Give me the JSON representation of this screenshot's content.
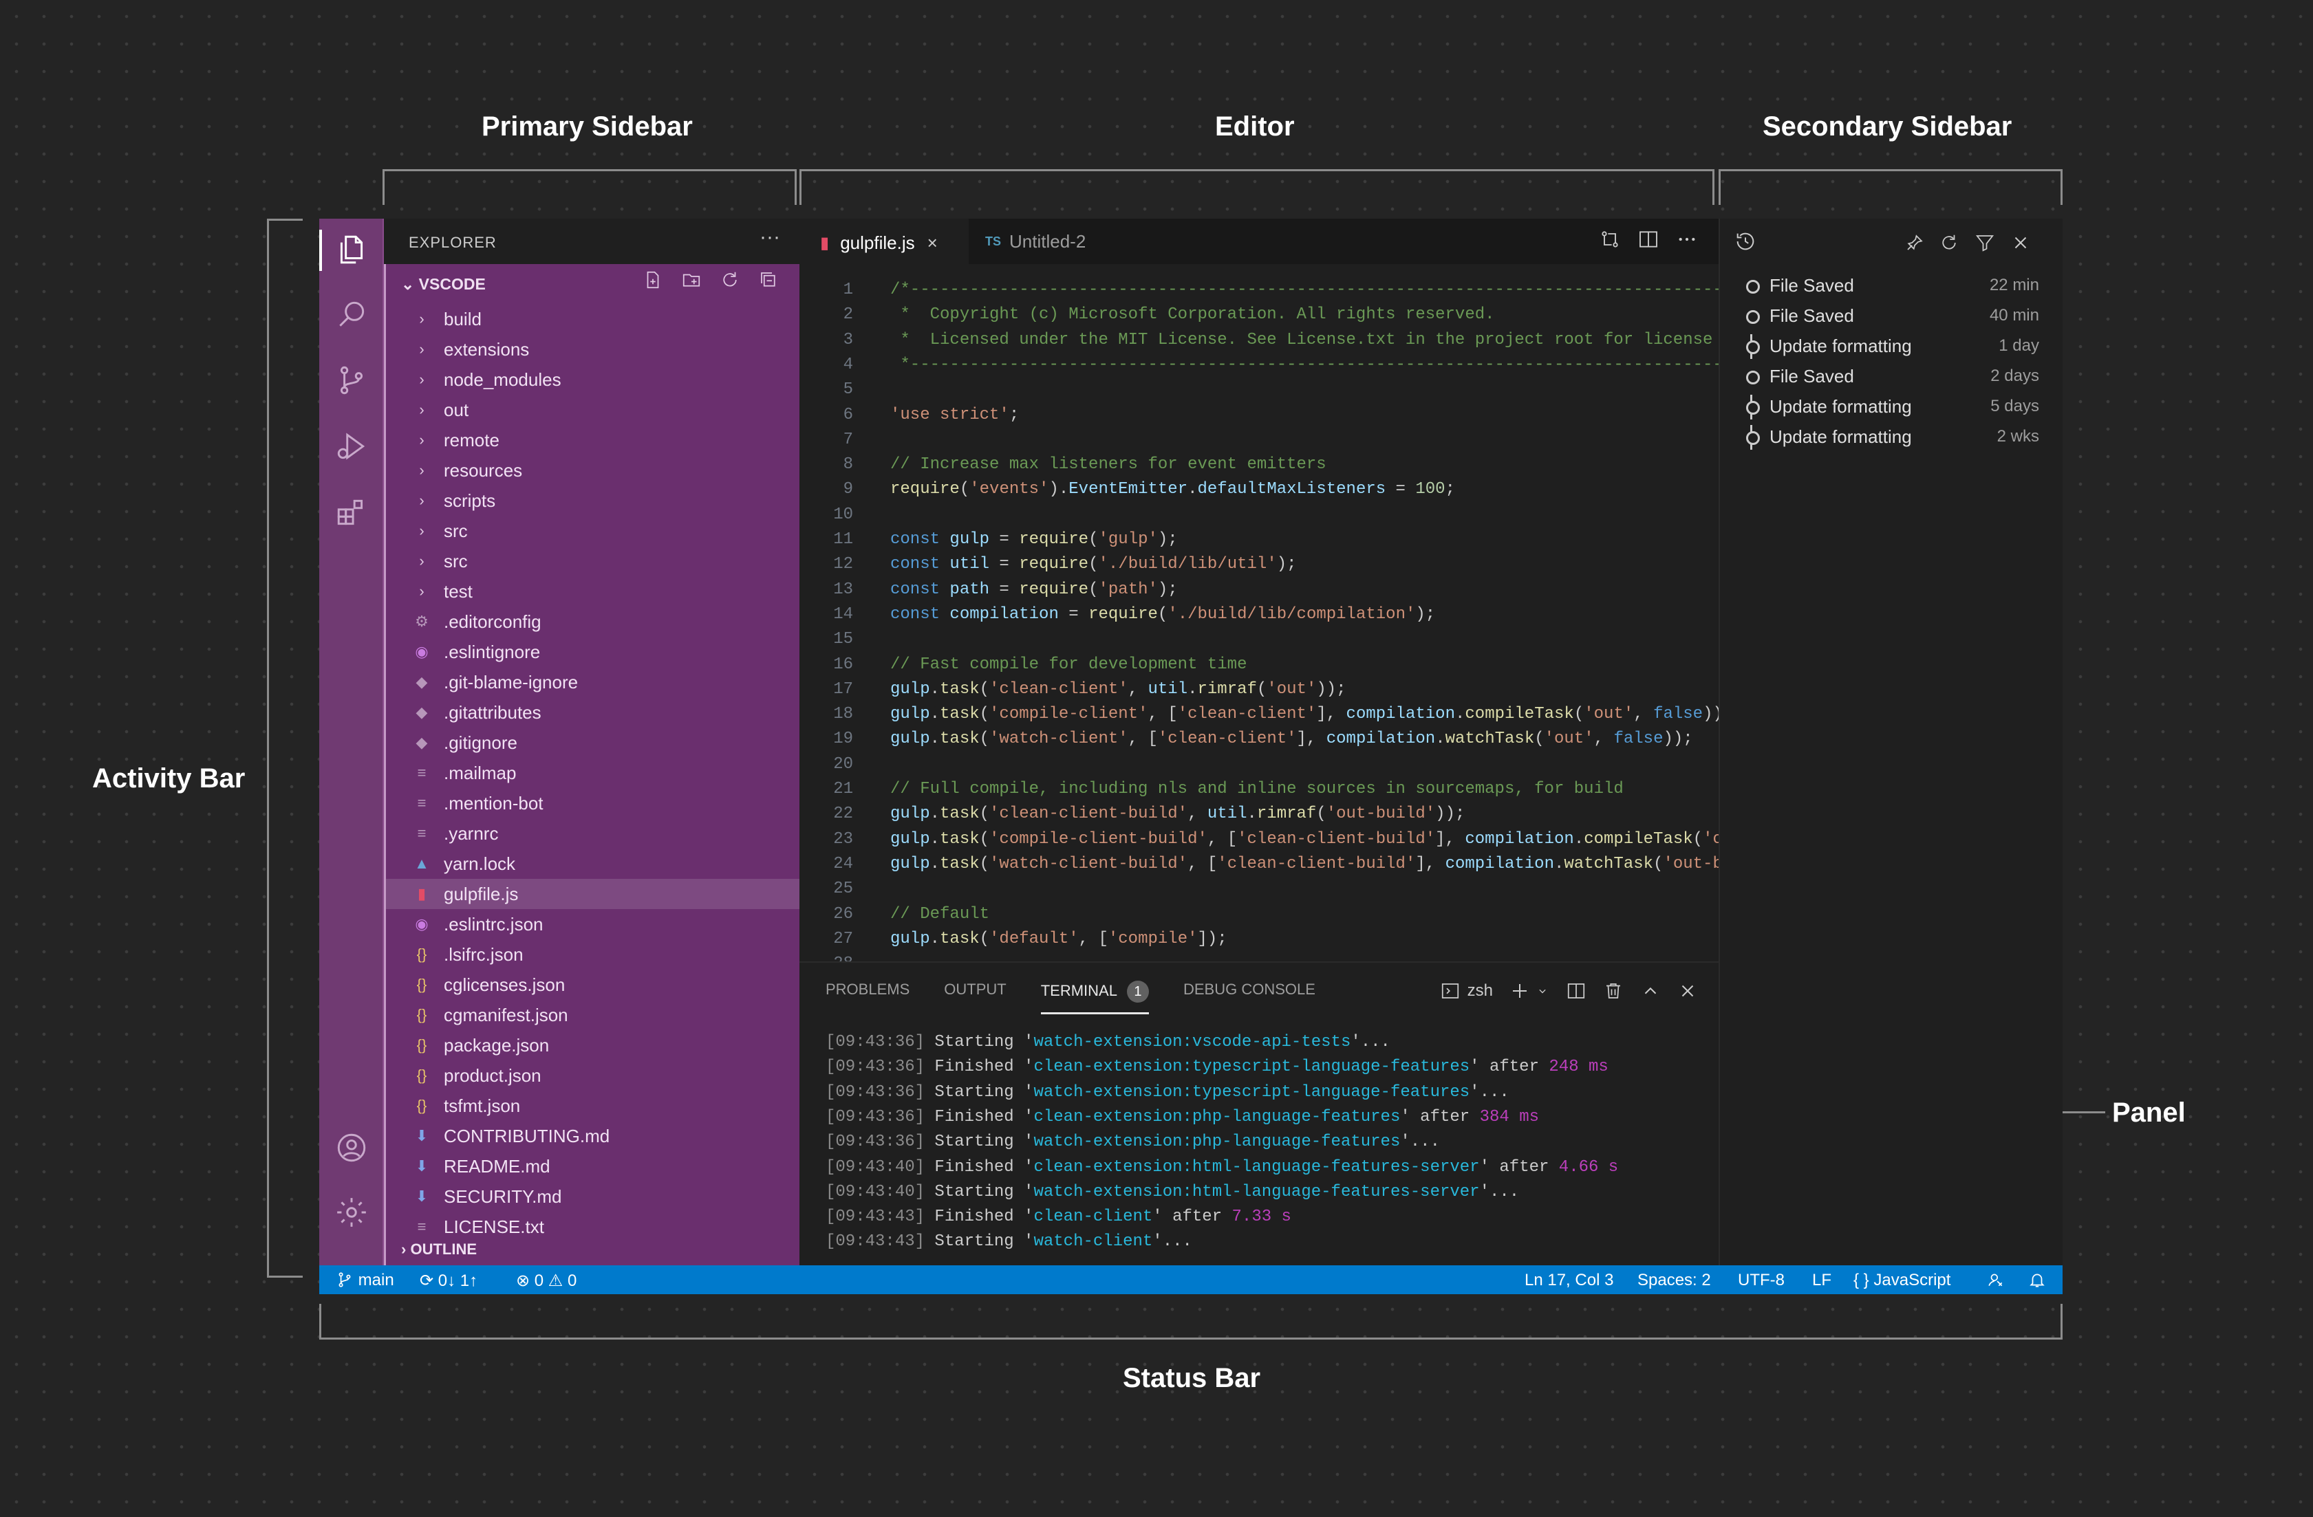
{
  "callouts": {
    "primary_sidebar": "Primary Sidebar",
    "editor": "Editor",
    "secondary_sidebar": "Secondary Sidebar",
    "activity_bar": "Activity Bar",
    "panel": "Panel",
    "status_bar": "Status Bar"
  },
  "activity_bar": {
    "icons": [
      "files-icon",
      "search-icon",
      "source-control-icon",
      "run-debug-icon",
      "extensions-icon",
      "account-icon",
      "settings-gear-icon"
    ]
  },
  "primary_sidebar": {
    "title": "EXPLORER",
    "more": "···",
    "section": "VSCODE",
    "outline": "OUTLINE",
    "tree": [
      {
        "label": "build",
        "icon": "›"
      },
      {
        "label": "extensions",
        "icon": "›"
      },
      {
        "label": "node_modules",
        "icon": "›"
      },
      {
        "label": "out",
        "icon": "›"
      },
      {
        "label": "remote",
        "icon": "›"
      },
      {
        "label": "resources",
        "icon": "›"
      },
      {
        "label": "scripts",
        "icon": "›"
      },
      {
        "label": "src",
        "icon": "›"
      },
      {
        "label": "src",
        "icon": "›"
      },
      {
        "label": "test",
        "icon": "›"
      },
      {
        "label": ".editorconfig",
        "icon": "⚙"
      },
      {
        "label": ".eslintignore",
        "icon": "◉"
      },
      {
        "label": ".git-blame-ignore",
        "icon": "◆"
      },
      {
        "label": ".gitattributes",
        "icon": "◆"
      },
      {
        "label": ".gitignore",
        "icon": "◆"
      },
      {
        "label": ".mailmap",
        "icon": "≡"
      },
      {
        "label": ".mention-bot",
        "icon": "≡"
      },
      {
        "label": ".yarnrc",
        "icon": "≡"
      },
      {
        "label": "yarn.lock",
        "icon": "▲"
      },
      {
        "label": "gulpfile.js",
        "icon": "▮"
      },
      {
        "label": ".eslintrc.json",
        "icon": "◉"
      },
      {
        "label": ".lsifrc.json",
        "icon": "{}"
      },
      {
        "label": "cglicenses.json",
        "icon": "{}"
      },
      {
        "label": "cgmanifest.json",
        "icon": "{}"
      },
      {
        "label": "package.json",
        "icon": "{}"
      },
      {
        "label": "product.json",
        "icon": "{}"
      },
      {
        "label": "tsfmt.json",
        "icon": "{}"
      },
      {
        "label": "CONTRIBUTING.md",
        "icon": "⬇"
      },
      {
        "label": "README.md",
        "icon": "⬇"
      },
      {
        "label": "SECURITY.md",
        "icon": "⬇"
      },
      {
        "label": "LICENSE.txt",
        "icon": "≡"
      }
    ],
    "selected_index": 19
  },
  "editor": {
    "tabs": [
      {
        "label": "gulpfile.js",
        "active": true,
        "close": "×"
      },
      {
        "label": "Untitled-2",
        "active": false,
        "prefix": "TS"
      }
    ],
    "lines": [
      [
        [
          "c-com",
          "/*---------------------------------------------------------------------------------------------"
        ]
      ],
      [
        [
          "c-com",
          " *  Copyright (c) Microsoft Corporation. All rights reserved."
        ]
      ],
      [
        [
          "c-com",
          " *  Licensed under the MIT License. See License.txt in the project root for license information."
        ]
      ],
      [
        [
          "c-com",
          " *--------------------------------------------------------------------------------------------*/"
        ]
      ],
      [],
      [
        [
          "c-str",
          "'use strict'"
        ],
        [
          "c-plain",
          ";"
        ]
      ],
      [],
      [
        [
          "c-com",
          "// Increase max listeners for event emitters"
        ]
      ],
      [
        [
          "c-fn",
          "require"
        ],
        [
          "c-plain",
          "("
        ],
        [
          "c-str",
          "'events'"
        ],
        [
          "c-plain",
          ")."
        ],
        [
          "c-var",
          "EventEmitter"
        ],
        [
          "c-plain",
          "."
        ],
        [
          "c-var",
          "defaultMaxListeners"
        ],
        [
          "c-plain",
          " = "
        ],
        [
          "c-num",
          "100"
        ],
        [
          "c-plain",
          ";"
        ]
      ],
      [],
      [
        [
          "c-kw",
          "const "
        ],
        [
          "c-var",
          "gulp"
        ],
        [
          "c-plain",
          " = "
        ],
        [
          "c-fn",
          "require"
        ],
        [
          "c-plain",
          "("
        ],
        [
          "c-str",
          "'gulp'"
        ],
        [
          "c-plain",
          ");"
        ]
      ],
      [
        [
          "c-kw",
          "const "
        ],
        [
          "c-var",
          "util"
        ],
        [
          "c-plain",
          " = "
        ],
        [
          "c-fn",
          "require"
        ],
        [
          "c-plain",
          "("
        ],
        [
          "c-str",
          "'./build/lib/util'"
        ],
        [
          "c-plain",
          ");"
        ]
      ],
      [
        [
          "c-kw",
          "const "
        ],
        [
          "c-var",
          "path"
        ],
        [
          "c-plain",
          " = "
        ],
        [
          "c-fn",
          "require"
        ],
        [
          "c-plain",
          "("
        ],
        [
          "c-str",
          "'path'"
        ],
        [
          "c-plain",
          ");"
        ]
      ],
      [
        [
          "c-kw",
          "const "
        ],
        [
          "c-var",
          "compilation"
        ],
        [
          "c-plain",
          " = "
        ],
        [
          "c-fn",
          "require"
        ],
        [
          "c-plain",
          "("
        ],
        [
          "c-str",
          "'./build/lib/compilation'"
        ],
        [
          "c-plain",
          ");"
        ]
      ],
      [],
      [
        [
          "c-com",
          "// Fast compile for development time"
        ]
      ],
      [
        [
          "c-var",
          "gulp"
        ],
        [
          "c-plain",
          "."
        ],
        [
          "c-fn",
          "task"
        ],
        [
          "c-plain",
          "("
        ],
        [
          "c-str",
          "'clean-client'"
        ],
        [
          "c-plain",
          ", "
        ],
        [
          "c-var",
          "util"
        ],
        [
          "c-plain",
          "."
        ],
        [
          "c-fn",
          "rimraf"
        ],
        [
          "c-plain",
          "("
        ],
        [
          "c-str",
          "'out'"
        ],
        [
          "c-plain",
          "));"
        ]
      ],
      [
        [
          "c-var",
          "gulp"
        ],
        [
          "c-plain",
          "."
        ],
        [
          "c-fn",
          "task"
        ],
        [
          "c-plain",
          "("
        ],
        [
          "c-str",
          "'compile-client'"
        ],
        [
          "c-plain",
          ", ["
        ],
        [
          "c-str",
          "'clean-client'"
        ],
        [
          "c-plain",
          "], "
        ],
        [
          "c-var",
          "compilation"
        ],
        [
          "c-plain",
          "."
        ],
        [
          "c-fn",
          "compileTask"
        ],
        [
          "c-plain",
          "("
        ],
        [
          "c-str",
          "'out'"
        ],
        [
          "c-plain",
          ", "
        ],
        [
          "c-kw",
          "false"
        ],
        [
          "c-plain",
          ")));"
        ]
      ],
      [
        [
          "c-var",
          "gulp"
        ],
        [
          "c-plain",
          "."
        ],
        [
          "c-fn",
          "task"
        ],
        [
          "c-plain",
          "("
        ],
        [
          "c-str",
          "'watch-client'"
        ],
        [
          "c-plain",
          ", ["
        ],
        [
          "c-str",
          "'clean-client'"
        ],
        [
          "c-plain",
          "], "
        ],
        [
          "c-var",
          "compilation"
        ],
        [
          "c-plain",
          "."
        ],
        [
          "c-fn",
          "watchTask"
        ],
        [
          "c-plain",
          "("
        ],
        [
          "c-str",
          "'out'"
        ],
        [
          "c-plain",
          ", "
        ],
        [
          "c-kw",
          "false"
        ],
        [
          "c-plain",
          "));"
        ]
      ],
      [],
      [
        [
          "c-com",
          "// Full compile, including nls and inline sources in sourcemaps, for build"
        ]
      ],
      [
        [
          "c-var",
          "gulp"
        ],
        [
          "c-plain",
          "."
        ],
        [
          "c-fn",
          "task"
        ],
        [
          "c-plain",
          "("
        ],
        [
          "c-str",
          "'clean-client-build'"
        ],
        [
          "c-plain",
          ", "
        ],
        [
          "c-var",
          "util"
        ],
        [
          "c-plain",
          "."
        ],
        [
          "c-fn",
          "rimraf"
        ],
        [
          "c-plain",
          "("
        ],
        [
          "c-str",
          "'out-build'"
        ],
        [
          "c-plain",
          "));"
        ]
      ],
      [
        [
          "c-var",
          "gulp"
        ],
        [
          "c-plain",
          "."
        ],
        [
          "c-fn",
          "task"
        ],
        [
          "c-plain",
          "("
        ],
        [
          "c-str",
          "'compile-client-build'"
        ],
        [
          "c-plain",
          ", ["
        ],
        [
          "c-str",
          "'clean-client-build'"
        ],
        [
          "c-plain",
          "], "
        ],
        [
          "c-var",
          "compilation"
        ],
        [
          "c-plain",
          "."
        ],
        [
          "c-fn",
          "compileTask"
        ],
        [
          "c-plain",
          "("
        ],
        [
          "c-str",
          "'out-build'"
        ],
        [
          "c-plain",
          ", "
        ],
        [
          "c-kw",
          "true"
        ],
        [
          "c-plain",
          ")));"
        ]
      ],
      [
        [
          "c-var",
          "gulp"
        ],
        [
          "c-plain",
          "."
        ],
        [
          "c-fn",
          "task"
        ],
        [
          "c-plain",
          "("
        ],
        [
          "c-str",
          "'watch-client-build'"
        ],
        [
          "c-plain",
          ", ["
        ],
        [
          "c-str",
          "'clean-client-build'"
        ],
        [
          "c-plain",
          "], "
        ],
        [
          "c-var",
          "compilation"
        ],
        [
          "c-plain",
          "."
        ],
        [
          "c-fn",
          "watchTask"
        ],
        [
          "c-plain",
          "("
        ],
        [
          "c-str",
          "'out-build'"
        ],
        [
          "c-plain",
          ", "
        ],
        [
          "c-kw",
          "true"
        ],
        [
          "c-plain",
          ")));"
        ]
      ],
      [],
      [
        [
          "c-com",
          "// Default"
        ]
      ],
      [
        [
          "c-var",
          "gulp"
        ],
        [
          "c-plain",
          "."
        ],
        [
          "c-fn",
          "task"
        ],
        [
          "c-plain",
          "("
        ],
        [
          "c-str",
          "'default'"
        ],
        [
          "c-plain",
          ", ["
        ],
        [
          "c-str",
          "'compile'"
        ],
        [
          "c-plain",
          "]);"
        ]
      ],
      []
    ]
  },
  "panel": {
    "tabs": [
      "PROBLEMS",
      "OUTPUT",
      "TERMINAL",
      "DEBUG CONSOLE"
    ],
    "active_tab": 2,
    "terminal_badge": "1",
    "shell": "zsh",
    "terminal_lines": [
      [
        [
          "t-time",
          "[09:43:36]"
        ],
        [
          "c-plain",
          " Starting '"
        ],
        [
          "t-name",
          "watch-extension:vscode-api-tests"
        ],
        [
          "c-plain",
          "'..."
        ]
      ],
      [
        [
          "t-time",
          "[09:43:36]"
        ],
        [
          "c-plain",
          " Finished '"
        ],
        [
          "t-name",
          "clean-extension:typescript-language-features"
        ],
        [
          "c-plain",
          "' after "
        ],
        [
          "t-dur",
          "248 ms"
        ]
      ],
      [
        [
          "t-time",
          "[09:43:36]"
        ],
        [
          "c-plain",
          " Starting '"
        ],
        [
          "t-name",
          "watch-extension:typescript-language-features"
        ],
        [
          "c-plain",
          "'..."
        ]
      ],
      [
        [
          "t-time",
          "[09:43:36]"
        ],
        [
          "c-plain",
          " Finished '"
        ],
        [
          "t-name",
          "clean-extension:php-language-features"
        ],
        [
          "c-plain",
          "' after "
        ],
        [
          "t-dur",
          "384 ms"
        ]
      ],
      [
        [
          "t-time",
          "[09:43:36]"
        ],
        [
          "c-plain",
          " Starting '"
        ],
        [
          "t-name",
          "watch-extension:php-language-features"
        ],
        [
          "c-plain",
          "'..."
        ]
      ],
      [
        [
          "t-time",
          "[09:43:40]"
        ],
        [
          "c-plain",
          " Finished '"
        ],
        [
          "t-name",
          "clean-extension:html-language-features-server"
        ],
        [
          "c-plain",
          "' after "
        ],
        [
          "t-dur",
          "4.66 s"
        ]
      ],
      [
        [
          "t-time",
          "[09:43:40]"
        ],
        [
          "c-plain",
          " Starting '"
        ],
        [
          "t-name",
          "watch-extension:html-language-features-server"
        ],
        [
          "c-plain",
          "'..."
        ]
      ],
      [
        [
          "t-time",
          "[09:43:43]"
        ],
        [
          "c-plain",
          " Finished '"
        ],
        [
          "t-name",
          "clean-client"
        ],
        [
          "c-plain",
          "' after "
        ],
        [
          "t-dur",
          "7.33 s"
        ]
      ],
      [
        [
          "t-time",
          "[09:43:43]"
        ],
        [
          "c-plain",
          " Starting '"
        ],
        [
          "t-name",
          "watch-client"
        ],
        [
          "c-plain",
          "'..."
        ]
      ]
    ]
  },
  "secondary_sidebar": {
    "timeline": [
      {
        "label": "File Saved",
        "time": "22 min",
        "kind": "save"
      },
      {
        "label": "File Saved",
        "time": "40 min",
        "kind": "save"
      },
      {
        "label": "Update formatting",
        "time": "1 day",
        "kind": "commit"
      },
      {
        "label": "File Saved",
        "time": "2 days",
        "kind": "save"
      },
      {
        "label": "Update formatting",
        "time": "5 days",
        "kind": "commit"
      },
      {
        "label": "Update formatting",
        "time": "2 wks",
        "kind": "commit"
      }
    ]
  },
  "status_bar": {
    "branch": "main",
    "sync": "0↓ 1↑",
    "problems": "⊗ 0 ⚠ 0",
    "cursor": "Ln 17, Col 3",
    "spaces": "Spaces: 2",
    "encoding": "UTF-8",
    "eol": "LF",
    "language": "{ } JavaScript",
    "color": "#007acc"
  },
  "colors": {
    "sidebar_bg": "#6a2f6e",
    "activity_bg": "#703a72",
    "editor_bg": "#1f1f1f",
    "background": "#242424"
  }
}
